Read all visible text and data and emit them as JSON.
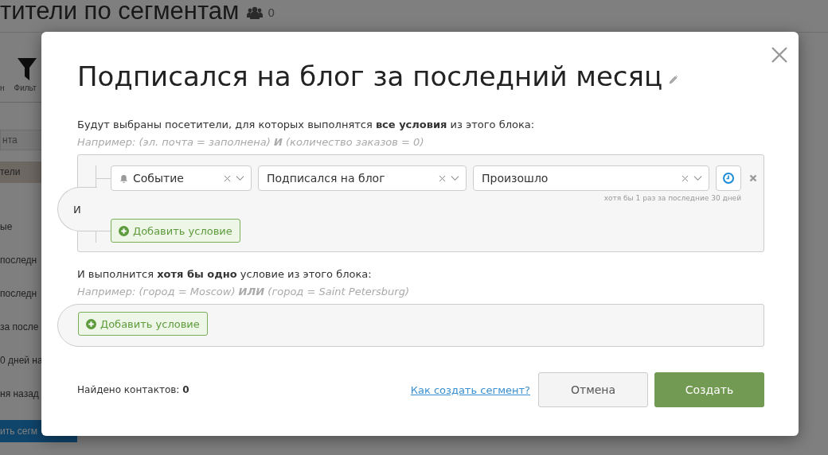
{
  "background_page": {
    "title": "тители по сегментам",
    "visitor_count": "0",
    "toolbar_labels": [
      "н",
      "Фильт"
    ],
    "search": {
      "placeholder": "нта"
    },
    "sidebar_items": [
      {
        "label": "тели",
        "selected": true
      },
      {
        "label": "ые",
        "selected": false
      },
      {
        "label": "последн",
        "selected": false
      },
      {
        "label": "последн",
        "selected": false
      },
      {
        "label": "за после",
        "selected": false
      },
      {
        "label": "0 дней на",
        "selected": false
      },
      {
        "label": "ня назад",
        "selected": false
      }
    ],
    "create_button": "ить сегм"
  },
  "dialog": {
    "title": "Подписался на блог за последний месяц",
    "all_block": {
      "intro": "Будут выбраны посетители, для которых выполнятся **все условия** из этого блока:",
      "example": "Например: (эл. почта = заполнена) **И** (количество заказов = 0)",
      "operator": "И",
      "conditions": [
        {
          "type": "Событие",
          "event": "Подписался на блог",
          "occurrence": "Произошло",
          "frequency_note": "хотя бы 1 раз за последние 30 дней"
        }
      ],
      "add_button": "Добавить условие"
    },
    "any_block": {
      "intro": "И выполнится **хотя бы одно** условие из этого блока:",
      "example": "Например: (город = Moscow) **ИЛИ** (город = Saint Petersburg)",
      "add_button": "Добавить условие"
    },
    "found_label": "Найдено контактов: **0**",
    "help_link": "Как создать сегмент?",
    "cancel_button": "Отмена",
    "create_button": "Создать"
  }
}
